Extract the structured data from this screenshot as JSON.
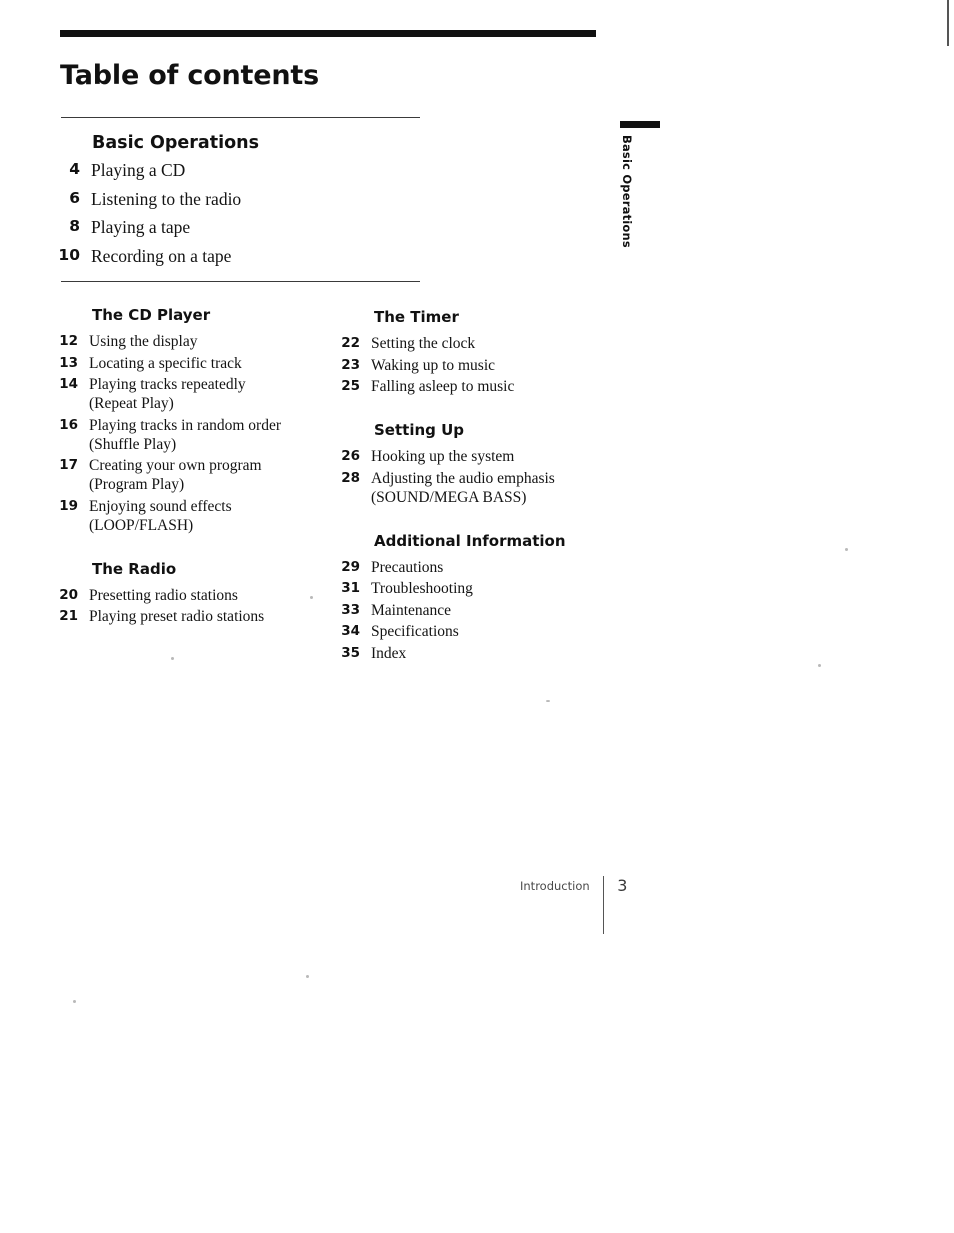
{
  "page": {
    "title": "Table of contents",
    "side_tab_label": "Basic Operations",
    "footer": {
      "label": "Introduction",
      "page_number": "3"
    }
  },
  "featured_section": {
    "heading": "Basic Operations",
    "entries": [
      {
        "page": "4",
        "title": "Playing a CD"
      },
      {
        "page": "6",
        "title": "Listening to the radio"
      },
      {
        "page": "8",
        "title": "Playing a tape"
      },
      {
        "page": "10",
        "title": "Recording on a tape"
      }
    ]
  },
  "columns": {
    "left": [
      {
        "heading": "The CD Player",
        "entries": [
          {
            "page": "12",
            "title": "Using the display",
            "subtitle": ""
          },
          {
            "page": "13",
            "title": "Locating a specific track",
            "subtitle": ""
          },
          {
            "page": "14",
            "title": "Playing tracks repeatedly",
            "subtitle": "(Repeat Play)"
          },
          {
            "page": "16",
            "title": "Playing tracks in random order",
            "subtitle": "(Shuffle Play)"
          },
          {
            "page": "17",
            "title": "Creating your own program",
            "subtitle": "(Program Play)"
          },
          {
            "page": "19",
            "title": "Enjoying sound effects",
            "subtitle": "(LOOP/FLASH)"
          }
        ]
      },
      {
        "heading": "The Radio",
        "entries": [
          {
            "page": "20",
            "title": "Presetting radio stations",
            "subtitle": ""
          },
          {
            "page": "21",
            "title": "Playing preset radio stations",
            "subtitle": ""
          }
        ]
      }
    ],
    "right": [
      {
        "heading": "The Timer",
        "entries": [
          {
            "page": "22",
            "title": "Setting the clock",
            "subtitle": ""
          },
          {
            "page": "23",
            "title": "Waking up to music",
            "subtitle": ""
          },
          {
            "page": "25",
            "title": "Falling asleep to music",
            "subtitle": ""
          }
        ]
      },
      {
        "heading": "Setting Up",
        "entries": [
          {
            "page": "26",
            "title": "Hooking up the system",
            "subtitle": ""
          },
          {
            "page": "28",
            "title": "Adjusting the audio emphasis",
            "subtitle": "(SOUND/MEGA BASS)"
          }
        ]
      },
      {
        "heading": "Additional Information",
        "entries": [
          {
            "page": "29",
            "title": "Precautions",
            "subtitle": ""
          },
          {
            "page": "31",
            "title": "Troubleshooting",
            "subtitle": ""
          },
          {
            "page": "33",
            "title": "Maintenance",
            "subtitle": ""
          },
          {
            "page": "34",
            "title": "Specifications",
            "subtitle": ""
          },
          {
            "page": "35",
            "title": "Index",
            "subtitle": ""
          }
        ]
      }
    ]
  }
}
